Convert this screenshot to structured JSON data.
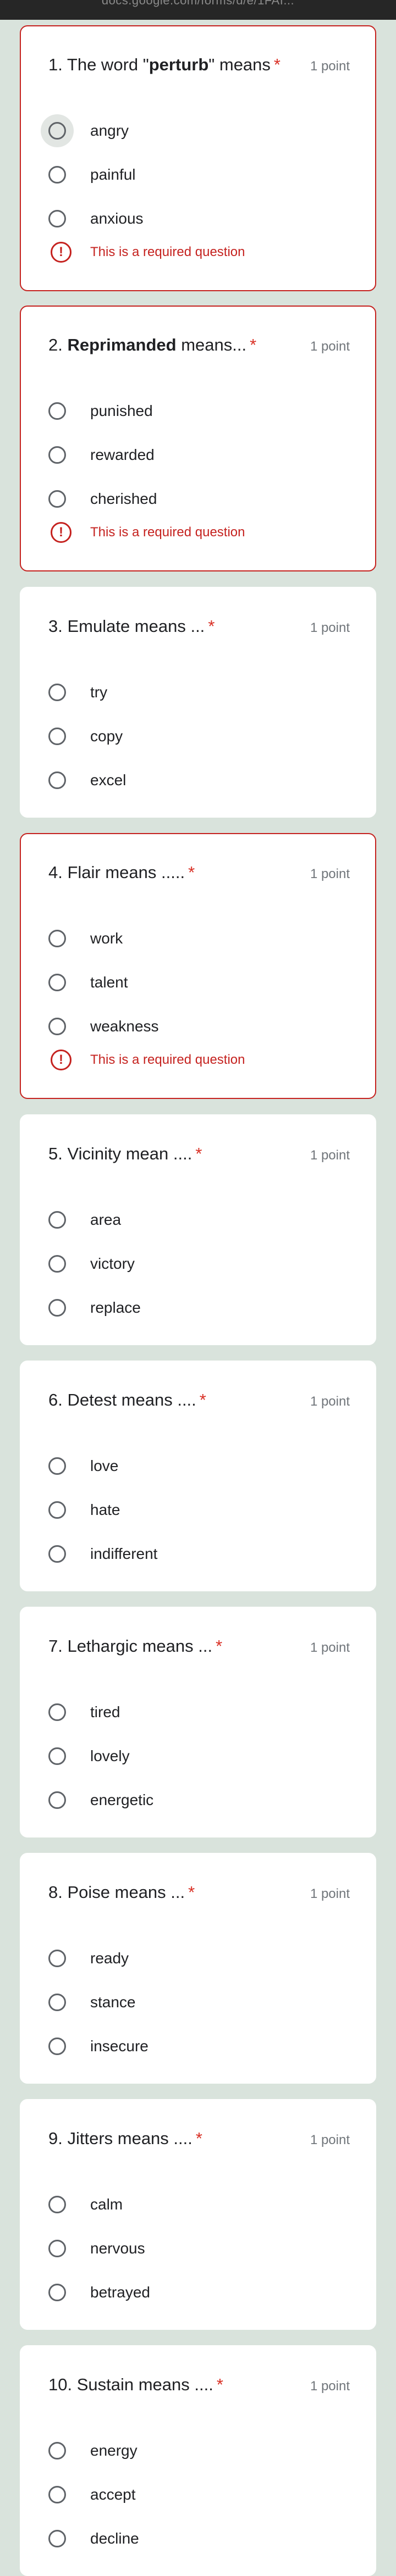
{
  "browser": {
    "url": "docs.google.com/forms/d/e/1FAI..."
  },
  "colors": {
    "required": "#d93025",
    "error": "#c5221f",
    "background": "#d9e3dc"
  },
  "questions": [
    {
      "pre": "1. The word \"",
      "bold": "perturb",
      "post": "\" means",
      "points": "1 point",
      "options": [
        "angry",
        "painful",
        "anxious"
      ],
      "error": "This is a required question"
    },
    {
      "pre": "2. ",
      "bold": "Reprimanded",
      "post": " means...",
      "points": "1 point",
      "options": [
        "punished",
        "rewarded",
        "cherished"
      ],
      "error": "This is a required question"
    },
    {
      "pre": "3. Emulate means ...",
      "bold": "",
      "post": "",
      "points": "1 point",
      "options": [
        "try",
        "copy",
        "excel"
      ]
    },
    {
      "pre": "4. Flair means .....",
      "bold": "",
      "post": "",
      "points": "1 point",
      "options": [
        "work",
        "talent",
        "weakness"
      ],
      "error": "This is a required question"
    },
    {
      "pre": "5. Vicinity mean ....",
      "bold": "",
      "post": "",
      "points": "1 point",
      "options": [
        "area",
        "victory",
        "replace"
      ]
    },
    {
      "pre": "6. Detest means ....",
      "bold": "",
      "post": "",
      "points": "1 point",
      "options": [
        "love",
        "hate",
        "indifferent"
      ]
    },
    {
      "pre": "7. Lethargic means ...",
      "bold": "",
      "post": "",
      "points": "1 point",
      "options": [
        "tired",
        "lovely",
        "energetic"
      ]
    },
    {
      "pre": "8. Poise means ...",
      "bold": "",
      "post": "",
      "points": "1 point",
      "options": [
        "ready",
        "stance",
        "insecure"
      ]
    },
    {
      "pre": "9. Jitters means ....",
      "bold": "",
      "post": "",
      "points": "1 point",
      "options": [
        "calm",
        "nervous",
        "betrayed"
      ]
    },
    {
      "pre": "10. Sustain means ....",
      "bold": "",
      "post": "",
      "points": "1 point",
      "options": [
        "energy",
        "accept",
        "decline"
      ]
    }
  ],
  "required_marker": "*",
  "error_icon": "error-exclamation-icon",
  "radio_icon": "radio-circle-icon"
}
